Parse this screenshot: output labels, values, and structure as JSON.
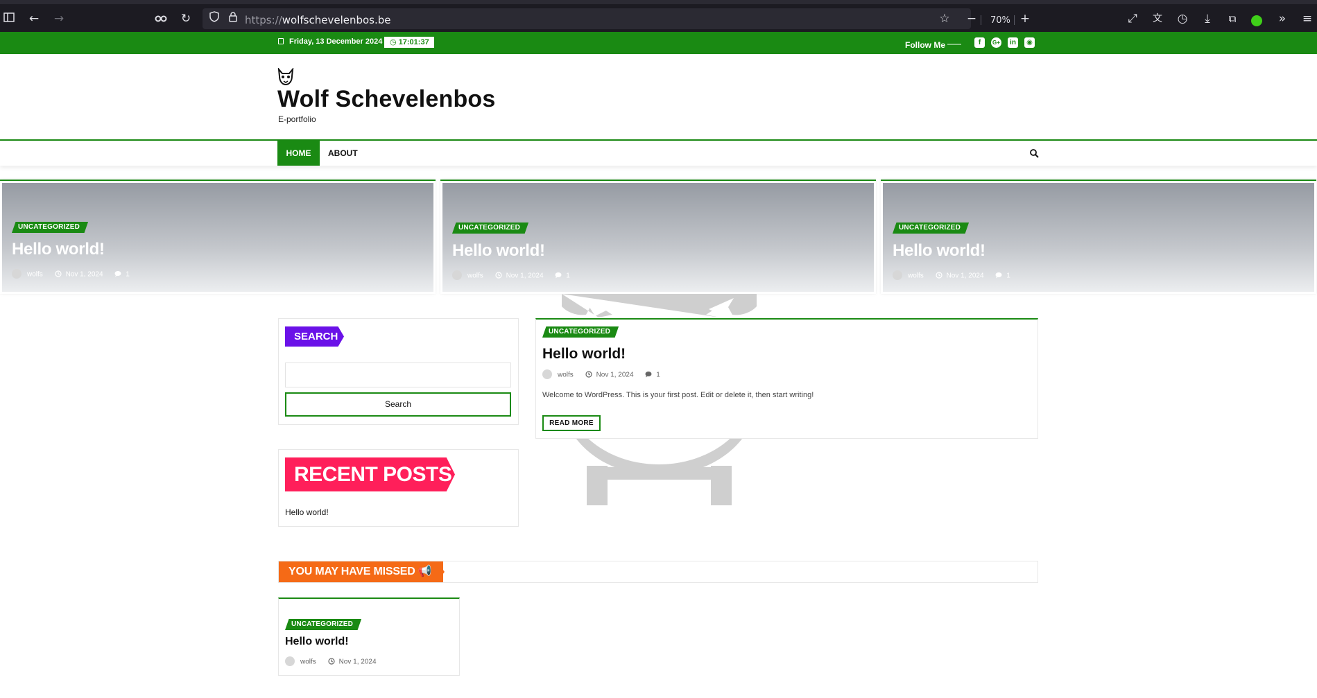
{
  "browser": {
    "url_prefix": "https://",
    "url_host": "wolfschevelenbos.be",
    "zoom": "70%"
  },
  "topbar": {
    "date": "Friday, 13 December 2024",
    "time": "17:01:37",
    "follow_label": "Follow Me",
    "social_icons": [
      "facebook-icon",
      "google-plus-icon",
      "linkedin-icon",
      "instagram-icon"
    ]
  },
  "header": {
    "site_title": "Wolf Schevelenbos",
    "tagline": "E-portfolio"
  },
  "nav": {
    "items": [
      {
        "label": "HOME",
        "active": true
      },
      {
        "label": "ABOUT",
        "active": false
      }
    ]
  },
  "featured": [
    {
      "category": "UNCATEGORIZED",
      "title": "Hello world!",
      "author": "wolfs",
      "date": "Nov 1, 2024",
      "comments": "1"
    },
    {
      "category": "UNCATEGORIZED",
      "title": "Hello world!",
      "author": "wolfs",
      "date": "Nov 1, 2024",
      "comments": "1"
    },
    {
      "category": "UNCATEGORIZED",
      "title": "Hello world!",
      "author": "wolfs",
      "date": "Nov 1, 2024",
      "comments": "1"
    }
  ],
  "sidebar": {
    "search": {
      "title": "SEARCH",
      "button_label": "Search",
      "placeholder": ""
    },
    "recent": {
      "title": "RECENT POSTS",
      "items": [
        "Hello world!"
      ]
    }
  },
  "post": {
    "category": "UNCATEGORIZED",
    "title": "Hello world!",
    "author": "wolfs",
    "date": "Nov 1, 2024",
    "comments": "1",
    "excerpt": "Welcome to WordPress. This is your first post. Edit or delete it, then start writing!",
    "read_more": "READ MORE"
  },
  "missed": {
    "title": "YOU MAY HAVE MISSED",
    "items": [
      {
        "category": "UNCATEGORIZED",
        "title": "Hello world!",
        "author": "wolfs",
        "date": "Nov 1, 2024"
      }
    ]
  },
  "colors": {
    "brand_green": "#1a8a13",
    "search_purple": "#6a11e8",
    "recent_pink": "#ff1f5a",
    "missed_orange": "#f56a16"
  }
}
